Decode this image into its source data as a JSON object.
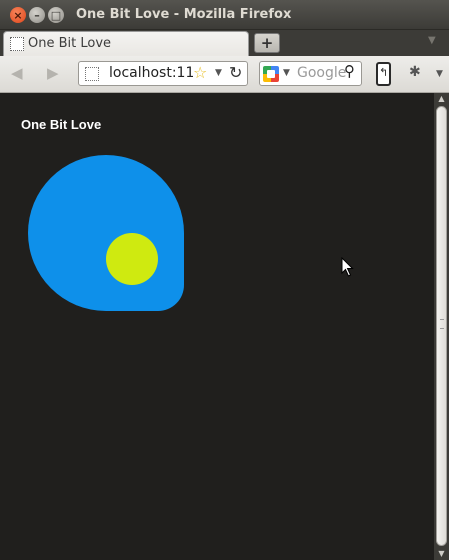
{
  "window": {
    "title": "One Bit Love - Mozilla Firefox"
  },
  "tabs": [
    {
      "label": "One Bit Love",
      "active": true
    }
  ],
  "navbar": {
    "url": "localhost:11",
    "search_placeholder": "Google"
  },
  "page": {
    "heading": "One Bit Love",
    "background": "#201f1d",
    "blob_color": "#0e90ea",
    "dot_color": "#cfea10"
  },
  "icons": {
    "close": "close-icon",
    "minimize": "minimize-icon",
    "maximize": "maximize-icon",
    "new_tab": "plus-icon",
    "back": "back-arrow-icon",
    "forward": "forward-arrow-icon",
    "bookmark": "star-icon",
    "reload": "reload-icon",
    "search_engine": "google-icon",
    "search": "magnifier-icon",
    "mobile": "phone-icon",
    "addon": "bug-icon"
  }
}
